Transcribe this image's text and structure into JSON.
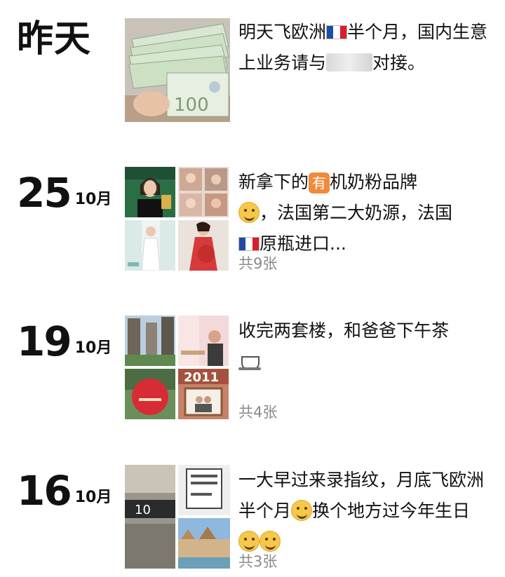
{
  "entries": [
    {
      "date_label": "昨天",
      "text_parts": [
        "明天飞欧洲",
        "半个月，国内生意上业务请与",
        "对接。"
      ],
      "count": ""
    },
    {
      "day": "25",
      "month": "10月",
      "text_parts": [
        "新拿下的",
        "有",
        "机奶粉品牌",
        "，法国第二大奶源，法国",
        "原瓶进口..."
      ],
      "count": "共9张"
    },
    {
      "day": "19",
      "month": "10月",
      "text_parts": [
        "收完两套楼，和爸爸下午茶"
      ],
      "count": "共4张"
    },
    {
      "day": "16",
      "month": "10月",
      "text_parts": [
        "一大早过来录指纹，月底飞欧洲半个月",
        "换个地方过今年生日"
      ],
      "count": "共3张"
    }
  ],
  "images": {
    "sign_text": "10",
    "cake_text": "2011"
  },
  "icons": {
    "flag": "france-flag-icon",
    "emoji_smile": "smiling-face-icon",
    "emoji_grin": "grinning-face-icon",
    "badge": "you-badge-icon",
    "cup": "coffee-cup-icon"
  },
  "colors": {
    "flag_blue": "#1f4aa8",
    "flag_white": "#ffffff",
    "flag_red": "#d5202c",
    "count_gray": "#8a8a8a"
  }
}
